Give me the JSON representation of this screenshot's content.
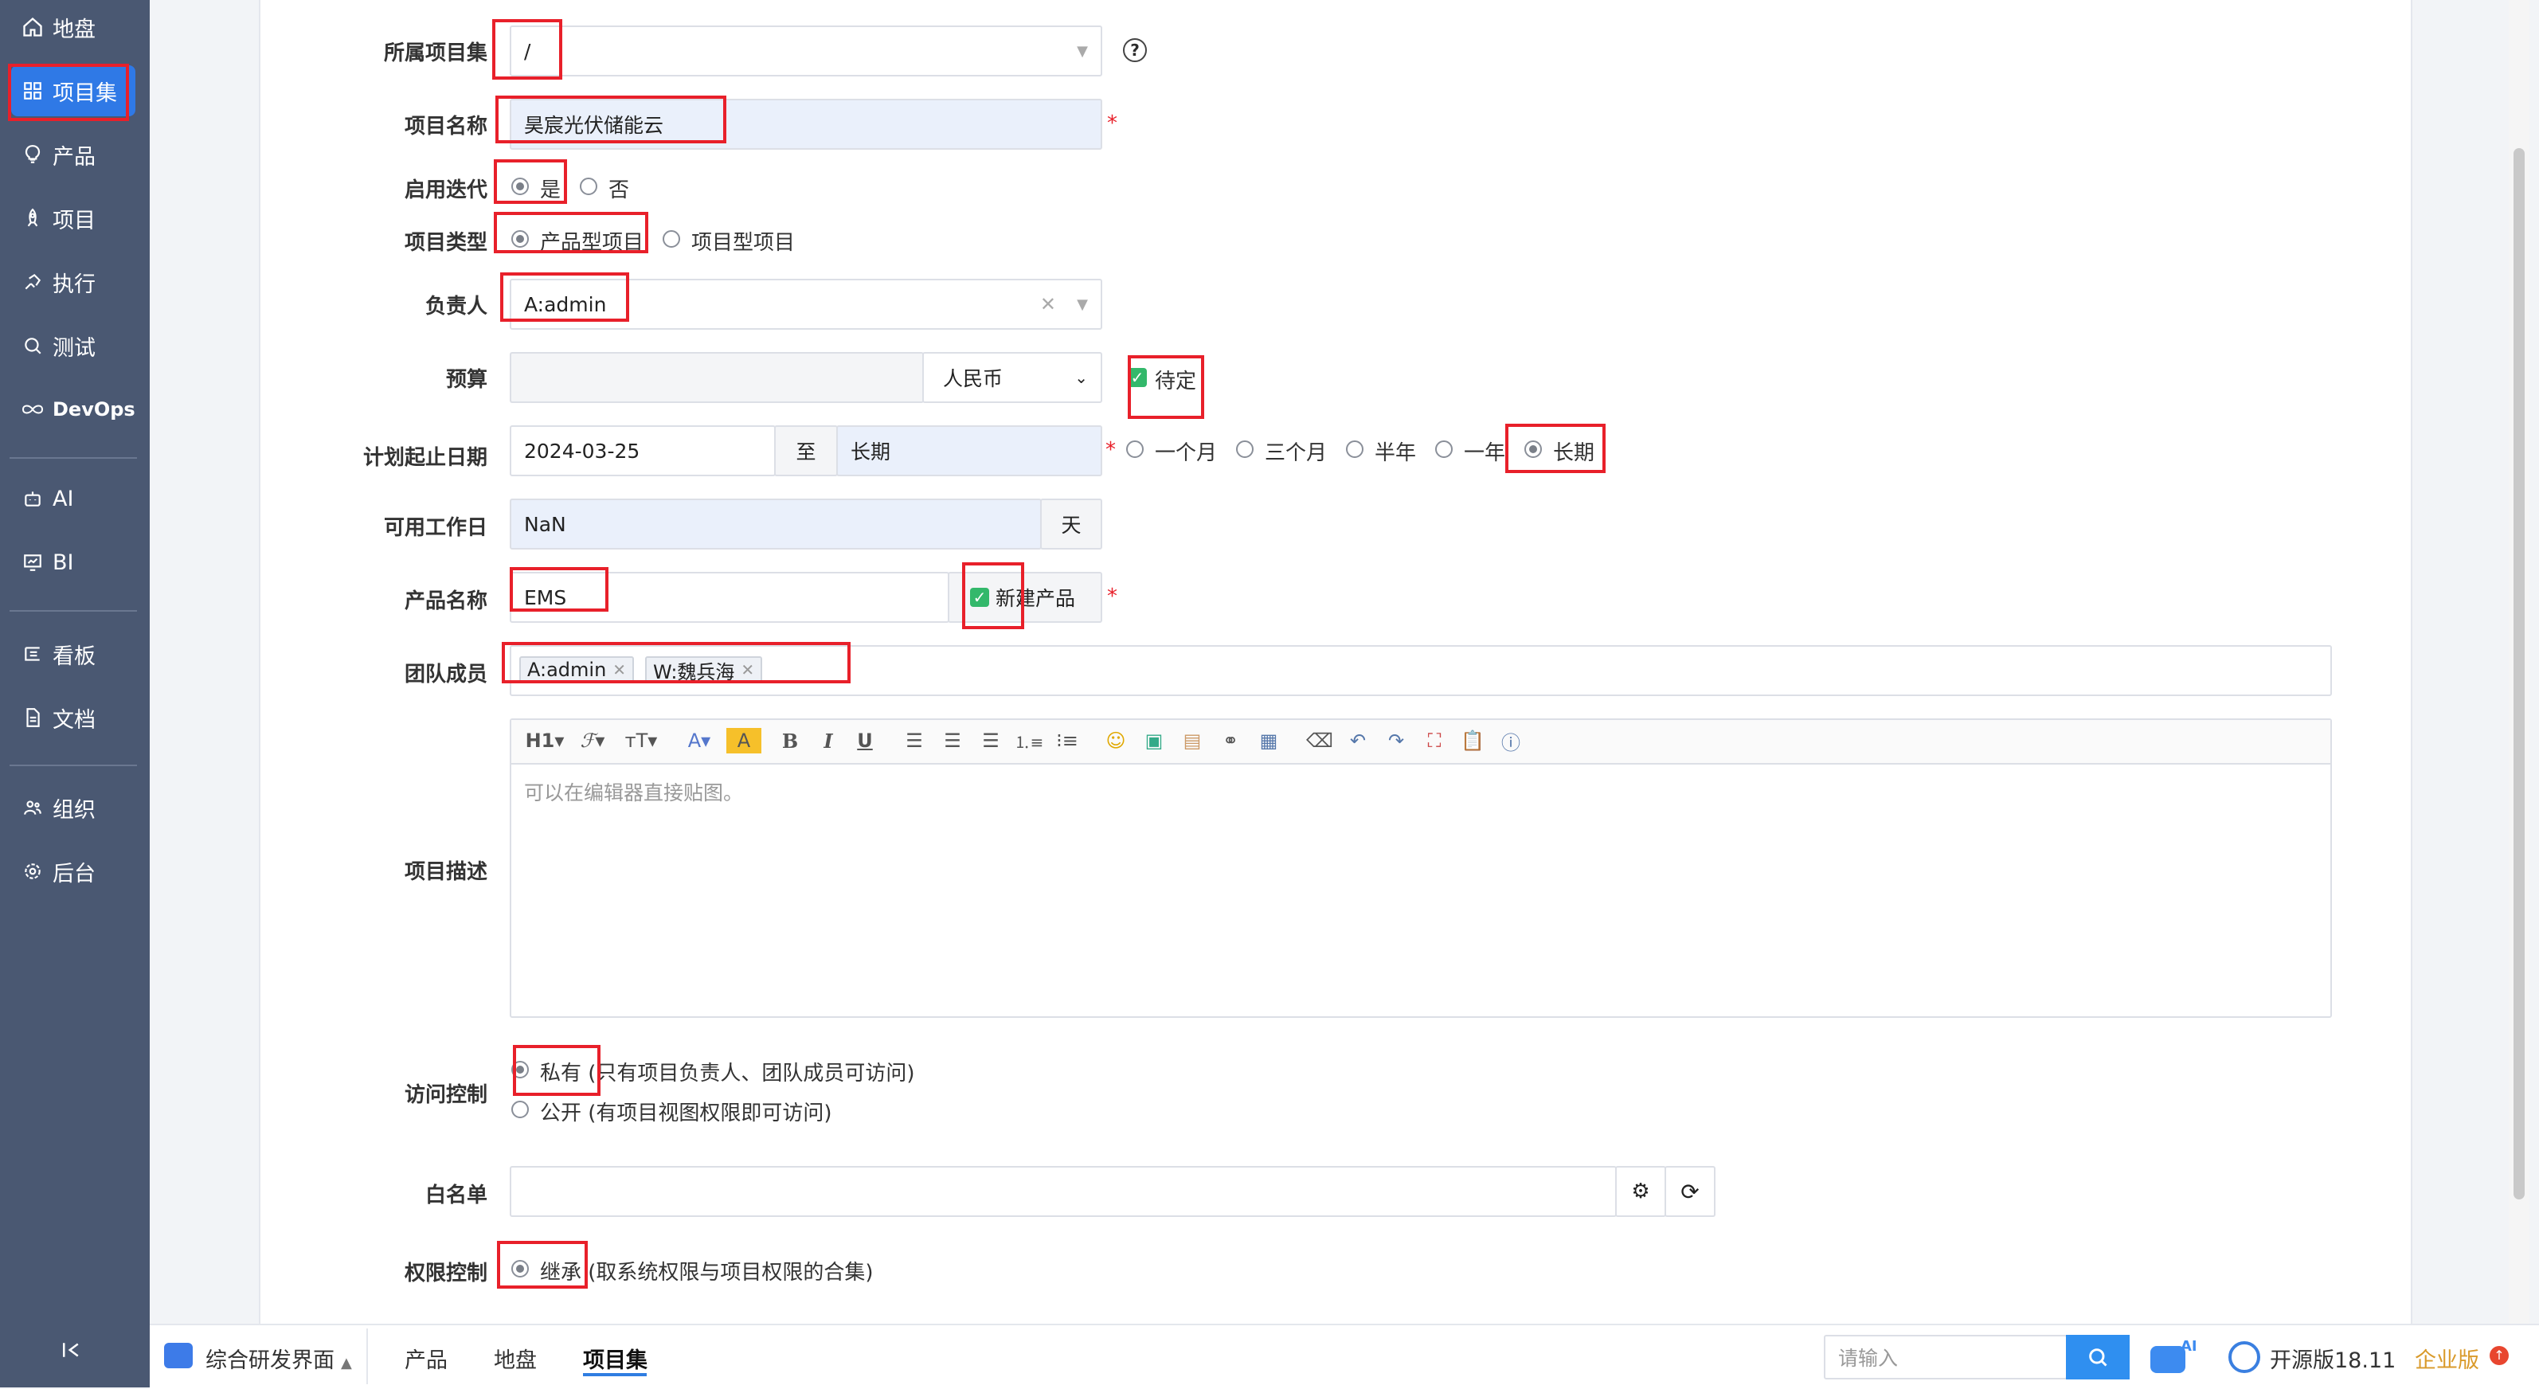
{
  "sidebar": {
    "items": [
      {
        "label": "地盘",
        "icon": "home-icon"
      },
      {
        "label": "项目集",
        "icon": "grid-icon",
        "active": true
      },
      {
        "label": "产品",
        "icon": "lightbulb-icon"
      },
      {
        "label": "项目",
        "icon": "rocket-icon"
      },
      {
        "label": "执行",
        "icon": "run-icon"
      },
      {
        "label": "测试",
        "icon": "search-icon"
      },
      {
        "label": "DevOps",
        "icon": "infinity-icon"
      },
      {
        "label": "AI",
        "icon": "robot-icon"
      },
      {
        "label": "BI",
        "icon": "chart-icon"
      },
      {
        "label": "看板",
        "icon": "board-icon"
      },
      {
        "label": "文档",
        "icon": "document-icon"
      },
      {
        "label": "组织",
        "icon": "people-icon"
      },
      {
        "label": "后台",
        "icon": "gear-icon"
      }
    ]
  },
  "form": {
    "program": {
      "label": "所属项目集",
      "value": "/"
    },
    "name": {
      "label": "项目名称",
      "value": "昊宸光伏储能云"
    },
    "iteration": {
      "label": "启用迭代",
      "options": [
        "是",
        "否"
      ],
      "selected": "是"
    },
    "type": {
      "label": "项目类型",
      "options": [
        "产品型项目",
        "项目型项目"
      ],
      "selected": "产品型项目"
    },
    "owner": {
      "label": "负责人",
      "value": "A:admin"
    },
    "budget": {
      "label": "预算",
      "value": "",
      "currency": "人民币",
      "pending_label": "待定",
      "pending_checked": true
    },
    "dates": {
      "label": "计划起止日期",
      "start": "2024-03-25",
      "sep": "至",
      "end": "长期",
      "presets": [
        "一个月",
        "三个月",
        "半年",
        "一年",
        "长期"
      ],
      "selected": "长期"
    },
    "workdays": {
      "label": "可用工作日",
      "value": "NaN",
      "unit": "天"
    },
    "product": {
      "label": "产品名称",
      "value": "EMS",
      "new_label": "新建产品",
      "new_checked": true
    },
    "team": {
      "label": "团队成员",
      "members": [
        "A:admin",
        "W:魏兵海"
      ]
    },
    "desc": {
      "label": "项目描述",
      "placeholder": "可以在编辑器直接贴图。"
    },
    "access": {
      "label": "访问控制",
      "options": [
        "私有 (只有项目负责人、团队成员可访问)",
        "公开 (有项目视图权限即可访问)"
      ],
      "selected": 0
    },
    "whitelist": {
      "label": "白名单",
      "value": ""
    },
    "acl": {
      "label": "权限控制",
      "option": "继承 (取系统权限与项目权限的合集)"
    }
  },
  "bottom": {
    "workspace": "综合研发界面",
    "tabs": [
      "产品",
      "地盘",
      "项目集"
    ],
    "active_tab": "项目集",
    "search_placeholder": "请输入",
    "ai_badge": "AI",
    "version": "开源版18.11",
    "enterprise": "企业版"
  },
  "colors": {
    "sidebar": "#4a5872",
    "active": "#2f79e6",
    "annotation": "#e8202a",
    "accent": "#2f7de1"
  }
}
